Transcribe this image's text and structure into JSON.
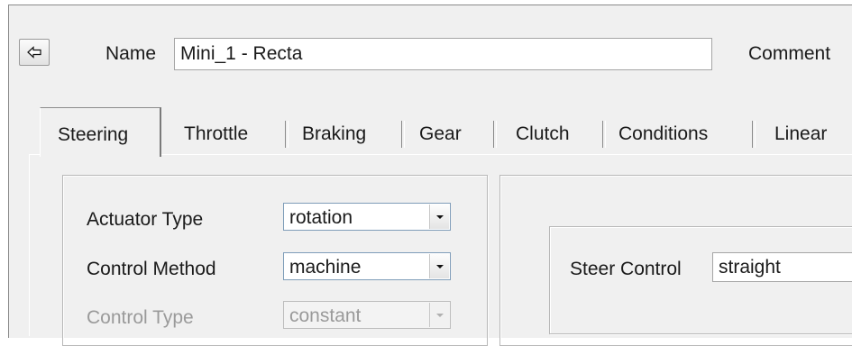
{
  "header": {
    "back_icon": "back-arrow-icon",
    "name_label": "Name",
    "name_value": "Mini_1 - Recta",
    "comment_label": "Comment"
  },
  "tabs": [
    {
      "label": "Steering",
      "active": true
    },
    {
      "label": "Throttle",
      "active": false
    },
    {
      "label": "Braking",
      "active": false
    },
    {
      "label": "Gear",
      "active": false
    },
    {
      "label": "Clutch",
      "active": false
    },
    {
      "label": "Conditions",
      "active": false
    },
    {
      "label": "Linear",
      "active": false
    }
  ],
  "steering": {
    "actuator_type": {
      "label": "Actuator Type",
      "value": "rotation",
      "enabled": true
    },
    "control_method": {
      "label": "Control Method",
      "value": "machine",
      "enabled": true
    },
    "control_type": {
      "label": "Control Type",
      "value": "constant",
      "enabled": false
    }
  },
  "steer_control": {
    "label": "Steer Control",
    "value": "straight"
  },
  "icons": {
    "dropdown": "chevron-down-icon"
  }
}
